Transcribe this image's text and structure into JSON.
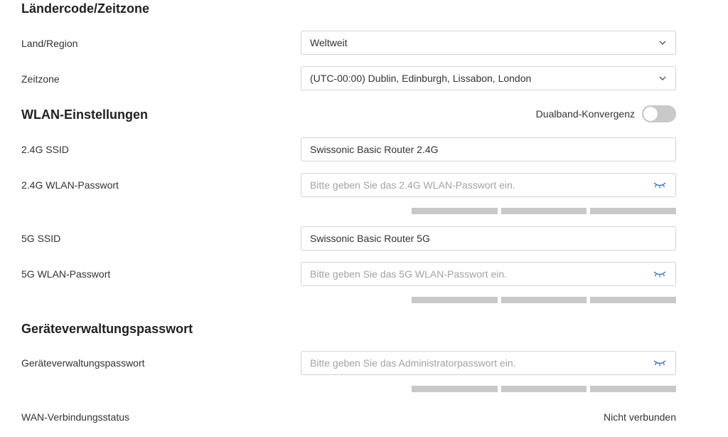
{
  "country_section": {
    "title": "Ländercode/Zeitzone",
    "region_label": "Land/Region",
    "region_value": "Weltweit",
    "timezone_label": "Zeitzone",
    "timezone_value": "(UTC-00:00) Dublin, Edinburgh, Lissabon, London"
  },
  "wlan_section": {
    "title": "WLAN-Einstellungen",
    "dualband_label": "Dualband-Konvergenz",
    "dualband_enabled": false,
    "ssid24_label": "2.4G SSID",
    "ssid24_value": "Swissonic Basic Router 2.4G",
    "pw24_label": "2.4G WLAN-Passwort",
    "pw24_placeholder": "Bitte geben Sie das 2.4G WLAN-Passwort ein.",
    "ssid5_label": "5G SSID",
    "ssid5_value": "Swissonic Basic Router 5G",
    "pw5_label": "5G WLAN-Passwort",
    "pw5_placeholder": "Bitte geben Sie das 5G WLAN-Passwort ein."
  },
  "admin_section": {
    "title": "Geräteverwaltungspasswort",
    "pw_label": "Geräteverwaltungspasswort",
    "pw_placeholder": "Bitte geben Sie das Administratorpasswort ein."
  },
  "wan": {
    "label": "WAN-Verbindungsstatus",
    "value": "Nicht verbunden"
  },
  "icons": {
    "select": "chevron-down-icon",
    "password": "eye-closed-icon"
  },
  "colors": {
    "strength_bar": "#c8c8c8",
    "toggle_off": "#c9c9c9",
    "eye_icon": "#3b6fb6"
  }
}
